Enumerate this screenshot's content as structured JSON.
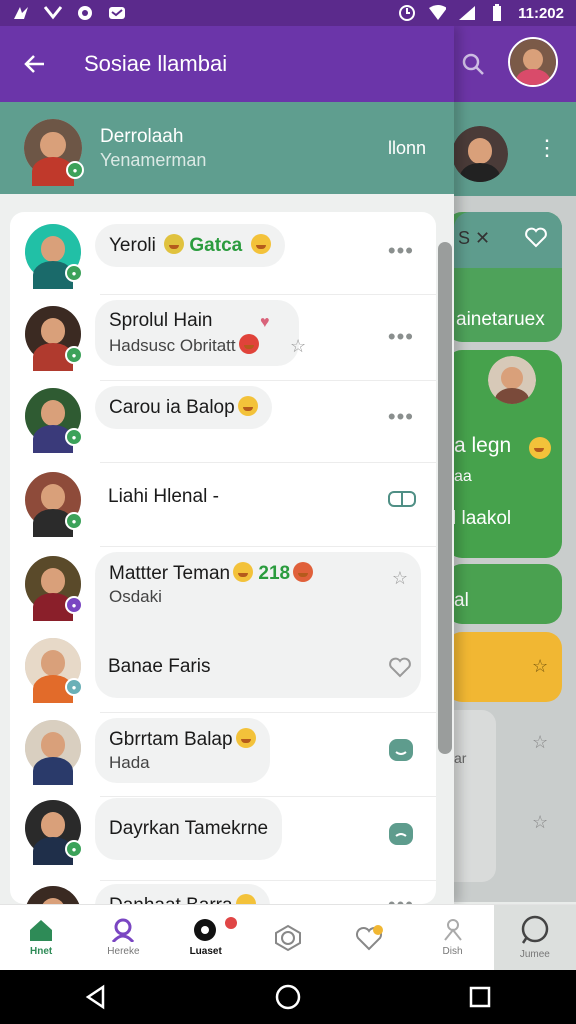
{
  "status_bar": {
    "time": "11:202",
    "icons": [
      "notification-icon",
      "mail-icon",
      "messenger-icon",
      "chat-icon",
      "alarm-icon",
      "wifi-icon",
      "signal-icon",
      "battery-icon"
    ]
  },
  "drawer": {
    "title": "Sosiae llambai",
    "profile": {
      "name": "Derrolaah",
      "subtitle": "Yenamerman",
      "action": "llonn"
    }
  },
  "contacts": [
    {
      "line1": "Yeroli",
      "emoji_text": "Gatca",
      "line2": "",
      "right": "more"
    },
    {
      "line1": "Sprolul Hain",
      "line2": "Hadsusc Obritatt",
      "right": "more"
    },
    {
      "line1": "Carou ia Balop",
      "line2": "",
      "right": "more"
    },
    {
      "line1": "Liahi Hlenal -",
      "line2": "",
      "right": "toggle"
    },
    {
      "line1": "Mattter Teman",
      "number": "218",
      "line2": "Osdaki",
      "right": "star"
    },
    {
      "line1": "Banae Faris",
      "line2": "",
      "right": "heart"
    },
    {
      "line1": "Gbrrtam Balap",
      "line2": "Hada",
      "right": "chat"
    },
    {
      "line1": "Dayrkan Tamekrne",
      "line2": "",
      "right": "chat"
    },
    {
      "line1": "Danhaat Barra",
      "line2": "",
      "right": "more"
    }
  ],
  "background": {
    "card_texts": [
      "ainetaruex",
      "a legn",
      "aa",
      "l laakol",
      "al",
      "ar"
    ]
  },
  "bottom_nav": [
    {
      "label": "Hnet",
      "icon": "home-icon",
      "active": true
    },
    {
      "label": "Hereke",
      "icon": "profile-icon",
      "active": false
    },
    {
      "label": "Luaset",
      "icon": "chat-bubble-icon",
      "active": false
    },
    {
      "label": "",
      "icon": "camera-icon",
      "active": false
    },
    {
      "label": "",
      "icon": "heart-badge-icon",
      "active": false
    },
    {
      "label": "Dish",
      "icon": "person-icon",
      "active": false
    },
    {
      "label": "Jumee",
      "icon": "search-icon",
      "active": false
    }
  ],
  "colors": {
    "status_bar": "#5b2a8c",
    "header_purple": "#6b35a9",
    "teal": "#5f9e8f",
    "online_green": "#3ca25a",
    "card_green": "#45a04a",
    "card_yellow": "#f1b733"
  }
}
